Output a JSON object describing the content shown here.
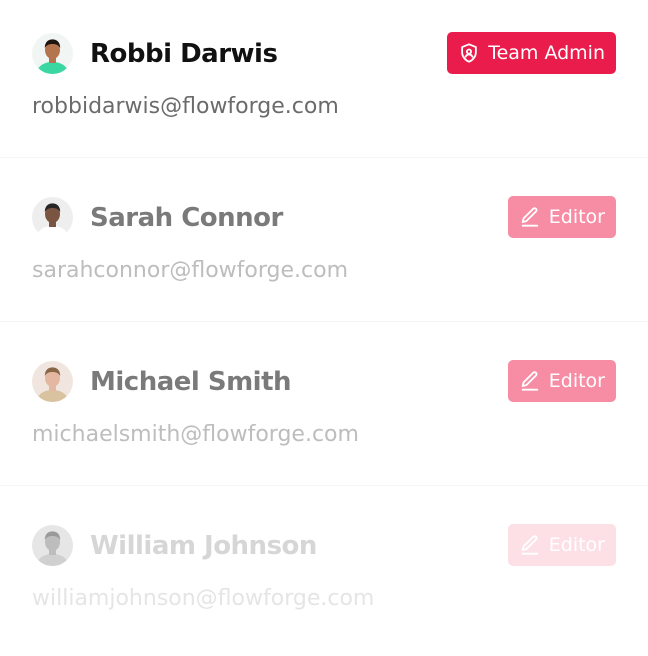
{
  "members": [
    {
      "name": "Robbi Darwis",
      "email": "robbidarwis@flowforge.com",
      "role": "Team Admin",
      "role_icon": "shield-user-icon",
      "name_color": "#111111",
      "email_color": "#6b6b6b",
      "badge_color": "#ea1c4c",
      "avatar_bg": "#f1f5f4",
      "shirt_color": "#3ad7a3",
      "skin_color": "#b4744d",
      "hair_color": "#1e1410"
    },
    {
      "name": "Sarah Connor",
      "email": "sarahconnor@flowforge.com",
      "role": "Editor",
      "role_icon": "pen-icon",
      "name_color": "#7a7a7a",
      "email_color": "#bdbdbd",
      "badge_color": "#f78da4",
      "avatar_bg": "#eeeeee",
      "shirt_color": "#ffffff",
      "skin_color": "#7a5642",
      "hair_color": "#262626"
    },
    {
      "name": "Michael Smith",
      "email": "michaelsmith@flowforge.com",
      "role": "Editor",
      "role_icon": "pen-icon",
      "name_color": "#7a7a7a",
      "email_color": "#bdbdbd",
      "badge_color": "#f78da4",
      "avatar_bg": "#f1e6df",
      "shirt_color": "#d9c2a0",
      "skin_color": "#e3b7a0",
      "hair_color": "#8a6547"
    },
    {
      "name": "William Johnson",
      "email": "williamjohnson@flowforge.com",
      "role": "Editor",
      "role_icon": "pen-icon",
      "name_color": "#d6d6d6",
      "email_color": "#e5e5e5",
      "badge_color": "#fde0e6",
      "avatar_bg": "#e6e6e6",
      "shirt_color": "#d0d0d0",
      "skin_color": "#bdbdbd",
      "hair_color": "#9a9a9a"
    }
  ]
}
